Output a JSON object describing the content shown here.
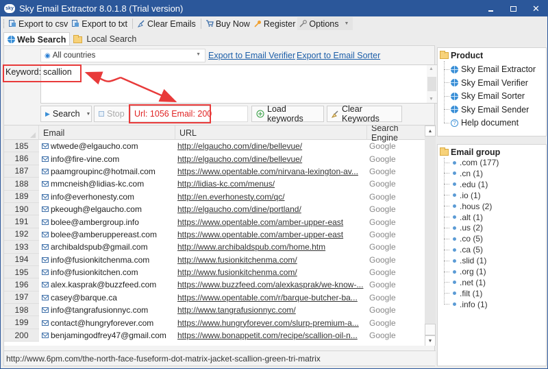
{
  "window": {
    "title": "Sky Email Extractor 8.0.1.8 (Trial version)",
    "app_icon_text": "sky",
    "controls": [
      "minimize",
      "maximize",
      "close"
    ]
  },
  "toolbar": {
    "export_csv": "Export to csv",
    "export_txt": "Export to txt",
    "clear_emails": "Clear Emails",
    "buy_now": "Buy Now",
    "register": "Register",
    "options": "Options"
  },
  "tabs": [
    {
      "label": "Web Search",
      "active": true
    },
    {
      "label": "Local Search",
      "active": false
    }
  ],
  "search": {
    "country": "All countries",
    "export_verifier_link": "Export to Email Verifier",
    "export_sorter_link": "Export to Email Sorter",
    "keyword_label": "Keyword:",
    "keyword_value": "scallion",
    "search_button": "Search",
    "stop_button": "Stop",
    "status": "Url: 1056 Email: 200",
    "load_keywords_button": "Load keywords",
    "clear_keywords_button": "Clear Keywords"
  },
  "table": {
    "columns": [
      "Email",
      "URL",
      "Search Engine"
    ],
    "rows": [
      {
        "n": "185",
        "email": "wtwede@elgaucho.com",
        "url": "http://elgaucho.com/dine/bellevue/",
        "engine": "Google"
      },
      {
        "n": "186",
        "email": "info@fire-vine.com",
        "url": "http://elgaucho.com/dine/bellevue/",
        "engine": "Google"
      },
      {
        "n": "187",
        "email": "paamgroupinc@hotmail.com",
        "url": "https://www.opentable.com/nirvana-lexington-av...",
        "engine": "Google"
      },
      {
        "n": "188",
        "email": "mmcneish@lidias-kc.com",
        "url": "http://lidias-kc.com/menus/",
        "engine": "Google"
      },
      {
        "n": "189",
        "email": "info@everhonesty.com",
        "url": "http://en.everhonesty.com/qc/",
        "engine": "Google"
      },
      {
        "n": "190",
        "email": "pkeough@elgaucho.com",
        "url": "http://elgaucho.com/dine/portland/",
        "engine": "Google"
      },
      {
        "n": "191",
        "email": "bolee@ambergroup.info",
        "url": "https://www.opentable.com/amber-upper-east",
        "engine": "Google"
      },
      {
        "n": "192",
        "email": "bolee@amberuppereast.com",
        "url": "https://www.opentable.com/amber-upper-east",
        "engine": "Google"
      },
      {
        "n": "193",
        "email": "archibaldspub@gmail.com",
        "url": "http://www.archibaldspub.com/home.htm",
        "engine": "Google"
      },
      {
        "n": "194",
        "email": "info@fusionkitchenma.com",
        "url": "http://www.fusionkitchenma.com/",
        "engine": "Google"
      },
      {
        "n": "195",
        "email": "info@fusionkitchen.com",
        "url": "http://www.fusionkitchenma.com/",
        "engine": "Google"
      },
      {
        "n": "196",
        "email": "alex.kasprak@buzzfeed.com",
        "url": "https://www.buzzfeed.com/alexkasprak/we-know-...",
        "engine": "Google"
      },
      {
        "n": "197",
        "email": "casey@barque.ca",
        "url": "https://www.opentable.com/r/barque-butcher-ba...",
        "engine": "Google"
      },
      {
        "n": "198",
        "email": "info@tangrafusionnyc.com",
        "url": "http://www.tangrafusionnyc.com/",
        "engine": "Google"
      },
      {
        "n": "199",
        "email": "contact@hungryforever.com",
        "url": "https://www.hungryforever.com/slurp-premium-a...",
        "engine": "Google"
      },
      {
        "n": "200",
        "email": "benjamingodfrey47@gmail.com",
        "url": "https://www.bonappetit.com/recipe/scallion-oil-n...",
        "engine": "Google"
      }
    ]
  },
  "statusbar": {
    "text": "http://www.6pm.com/the-north-face-fuseform-dot-matrix-jacket-scallion-green-tri-matrix"
  },
  "product_panel": {
    "title": "Product",
    "items": [
      {
        "label": "Sky Email Extractor",
        "icon": "globe-icon"
      },
      {
        "label": "Sky Email Verifier",
        "icon": "globe-icon"
      },
      {
        "label": "Sky Email Sorter",
        "icon": "globe-icon"
      },
      {
        "label": "Sky Email Sender",
        "icon": "globe-icon"
      },
      {
        "label": "Help document",
        "icon": "help-icon"
      }
    ]
  },
  "email_group_panel": {
    "title": "Email group",
    "items": [
      ".com (177)",
      ".cn (1)",
      ".edu (1)",
      ".io (1)",
      ".hous (2)",
      ".alt (1)",
      ".us (2)",
      ".co (5)",
      ".ca (5)",
      ".slid (1)",
      ".org (1)",
      ".net (1)",
      ".filt (1)",
      ".info (1)"
    ]
  },
  "colors": {
    "titlebar": "#2b579a",
    "annotation_red": "#e83a3a",
    "status_red": "#e02424",
    "link_blue": "#1c5ea8"
  }
}
